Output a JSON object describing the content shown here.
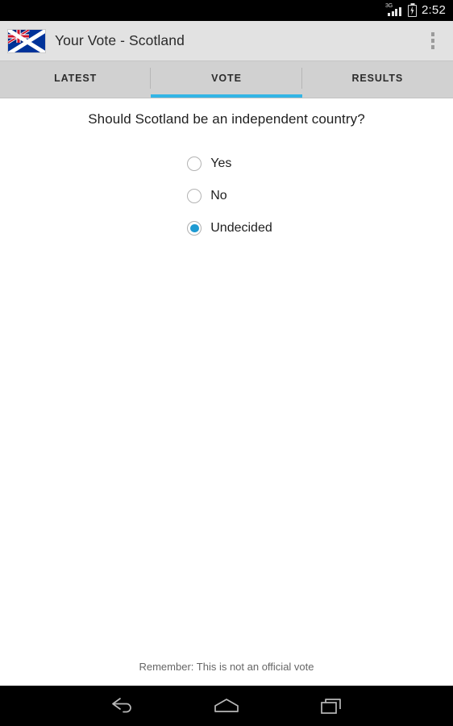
{
  "status_bar": {
    "network_label": "3G",
    "signal_icon": "signal-bars-icon",
    "battery_icon": "battery-charging-icon",
    "time": "2:52"
  },
  "action_bar": {
    "app_icon": "union-jack-saltire-flag-icon",
    "title": "Your Vote - Scotland",
    "overflow_icon": "overflow-menu-icon"
  },
  "tabs": {
    "items": [
      {
        "label": "LATEST",
        "active": false
      },
      {
        "label": "VOTE",
        "active": true
      },
      {
        "label": "RESULTS",
        "active": false
      }
    ],
    "indicator_color": "#33b5e5"
  },
  "poll": {
    "question": "Should Scotland be an independent country?",
    "options": [
      {
        "label": "Yes",
        "selected": false
      },
      {
        "label": "No",
        "selected": false
      },
      {
        "label": "Undecided",
        "selected": true
      }
    ],
    "selected_color": "#1e9ad2"
  },
  "footer": {
    "note": "Remember: This is not an official vote"
  },
  "nav_bar": {
    "back_icon": "back-arrow-icon",
    "home_icon": "home-icon",
    "recents_icon": "recent-apps-icon"
  }
}
